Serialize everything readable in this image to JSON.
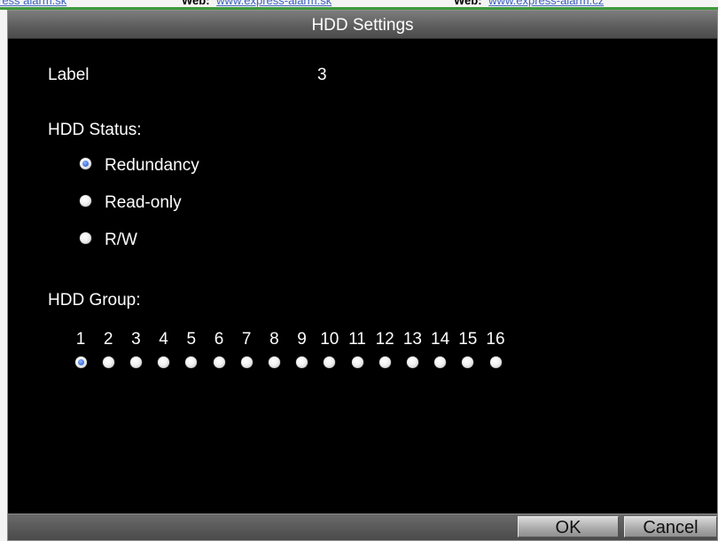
{
  "web_header": {
    "segments": [
      {
        "label": "",
        "link": "ress alarm.sk"
      },
      {
        "label": "Web:",
        "link": "www.express-alarm.sk"
      },
      {
        "label": "Web:",
        "link": "www.express-alarm.cz"
      }
    ]
  },
  "dialog": {
    "title": "HDD Settings",
    "label_field": {
      "label": "Label",
      "value": "3"
    },
    "hdd_status": {
      "heading": "HDD Status:",
      "options": [
        {
          "label": "Redundancy",
          "selected": true
        },
        {
          "label": "Read-only",
          "selected": false
        },
        {
          "label": "R/W",
          "selected": false
        }
      ]
    },
    "hdd_group": {
      "heading": "HDD Group:",
      "groups": [
        "1",
        "2",
        "3",
        "4",
        "5",
        "6",
        "7",
        "8",
        "9",
        "10",
        "11",
        "12",
        "13",
        "14",
        "15",
        "16"
      ],
      "selected": "1"
    },
    "buttons": {
      "ok": "OK",
      "cancel": "Cancel"
    }
  },
  "colors": {
    "window_bg": "#000000",
    "title_bar": "#6a6a6a",
    "accent_green": "#3d9a3b",
    "link_blue": "#3d62c0",
    "radio_selected": "#3a6fd8"
  }
}
